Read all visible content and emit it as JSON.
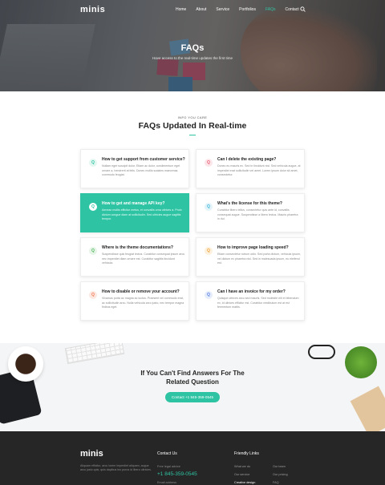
{
  "nav": {
    "logo": "minis",
    "items": [
      "Home",
      "About",
      "Service",
      "Portfolios",
      "FAQs",
      "Contact"
    ],
    "active_item": "FAQs"
  },
  "hero": {
    "title": "FAQs",
    "subtitle": "Have access to the real-time updates the first time"
  },
  "faq_section": {
    "eyebrow": "INFO YOU CARE",
    "title": "FAQs Updated In Real-time",
    "badge": "Q",
    "cards": [
      {
        "title": "How to get support from customer service?",
        "body": "Nullam eget suscipit dolor. Etiam ac dolor, condimentum eget ornare a, hendrerit at felis. Donec mollis sodales maecenas commodo feugiat.",
        "accent": "#2ec4a3",
        "badge_bg": "#e3f7f1",
        "active": false
      },
      {
        "title": "Can I delete the existing page?",
        "body": "Donec eu mauris ex. Sed in tincidunt nisl. Sed vehicula augue, at imperdiet erat sollicitudin vel amet. Lorem ipsum dolor sit amet, consectetur.",
        "accent": "#e85d75",
        "badge_bg": "#fde6ea",
        "active": false
      },
      {
        "title": "How to get and manage API key?",
        "body": "Aenean mollis efficitur metus, et convallis urna ultrices a. Proin dictum congue diam at sollicitudin. Sed ultricies augue sagittis tempor.",
        "accent": "#2ec4a3",
        "badge_bg": "#ffffff",
        "active": true
      },
      {
        "title": "What's the license for this theme?",
        "body": "Curabitur libero tellus, consectetur quis ante id, convallis consequat augue. Suspendisse a libero lectus. Mauris pharetra in dui.",
        "accent": "#3fb6d8",
        "badge_bg": "#e2f4fa",
        "active": false
      },
      {
        "title": "Where is the theme documentations?",
        "body": "Suspendisse quis feugiat lectus. Curabitur consequat ipsum arcu nec imperdiet diam ornare est. Curabitur sagittis tincidunt vehicula.",
        "accent": "#52b95f",
        "badge_bg": "#e6f5e8",
        "active": false
      },
      {
        "title": "How to improve page loading speed?",
        "body": "Etiam consectetur rutrum odio. Sed porta dictum, vehicula ipsum, vel dictum ex pharetra nisl. Sed in malesuada ipsum, eu eleifend est.",
        "accent": "#f0a33a",
        "badge_bg": "#fdf0dc",
        "active": false
      },
      {
        "title": "How to disable or remove your account?",
        "body": "Vivamus porta ac magna ac luctus. Praesent vel commodo erat, ac sollicitudin arcu. Nulla vehicula arcu justo, nec tempor magna finibus eget.",
        "accent": "#f07a55",
        "badge_bg": "#fde8e1",
        "active": false
      },
      {
        "title": "Can I have an invoice for my order?",
        "body": "Quisque ultrices arcu sed mauris. Sed molestie elit et bibendum ex, id ultrices efficitur est. Curabitur vestibulum est at est fermentum mattis.",
        "accent": "#5a7fe0",
        "badge_bg": "#e5ecfb",
        "active": false
      }
    ]
  },
  "cta": {
    "title_line1": "If You Can't Find Answers For The",
    "title_line2": "Related Question",
    "button": "Contact +1 845-359-0545"
  },
  "footer": {
    "logo": "minis",
    "description": "Aliquam efficitur, arcu lorem imperdiet aliquam, augue arcu justo quis, quis dapibus leo purus id libero ultricies.",
    "contact_heading": "Contact Us",
    "contact_label": "Free legal advice",
    "phone": "+1 845-359-0545",
    "contact_extra": "Email address",
    "links_heading": "Friendly Links",
    "links_col1": [
      "What we do",
      "Our service",
      "Creative design"
    ],
    "links_col2": [
      "Our team",
      "Our pricing",
      "FAQ"
    ],
    "highlight_link": "Creative design"
  }
}
